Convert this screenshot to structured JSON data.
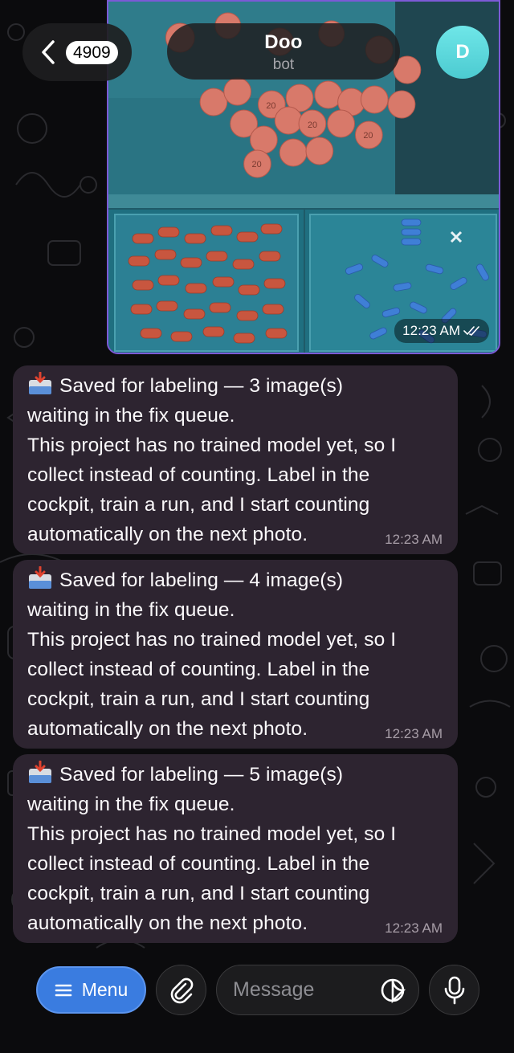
{
  "header": {
    "back_count": "4909",
    "chat_name": "Doo",
    "chat_subtitle": "bot",
    "avatar_initial": "D",
    "avatar_color": "#5ad6dc"
  },
  "photo_message": {
    "time": "12:23 AM",
    "status": "read-double-check-icon",
    "tablet_marking": "20"
  },
  "messages": [
    {
      "icon": "inbox-tray-icon",
      "lines": [
        "Saved for labeling — 3 image(s)",
        "waiting in the fix queue.",
        "This project has no trained model yet, so I",
        "collect instead of counting. Label in the",
        "cockpit, train a run, and I start counting",
        "automatically on the next photo."
      ],
      "time": "12:23 AM"
    },
    {
      "icon": "inbox-tray-icon",
      "lines": [
        "Saved for labeling — 4 image(s)",
        "waiting in the fix queue.",
        "This project has no trained model yet, so I",
        "collect instead of counting. Label in the",
        "cockpit, train a run, and I start counting",
        "automatically on the next photo."
      ],
      "time": "12:23 AM"
    },
    {
      "icon": "inbox-tray-icon",
      "lines": [
        "Saved for labeling — 5 image(s)",
        "waiting in the fix queue.",
        "This project has no trained model yet, so I",
        "collect instead of counting. Label in the",
        "cockpit, train a run, and I start counting",
        "automatically on the next photo."
      ],
      "time": "12:23 AM"
    }
  ],
  "composer": {
    "menu_label": "Menu",
    "placeholder": "Message",
    "accent": "#3a7ce0"
  }
}
